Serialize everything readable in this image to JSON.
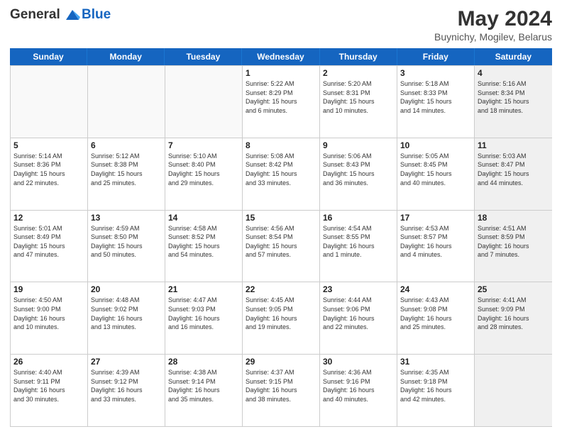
{
  "header": {
    "logo_line1": "General",
    "logo_line2": "Blue",
    "month_year": "May 2024",
    "location": "Buynichy, Mogilev, Belarus"
  },
  "days_of_week": [
    "Sunday",
    "Monday",
    "Tuesday",
    "Wednesday",
    "Thursday",
    "Friday",
    "Saturday"
  ],
  "weeks": [
    [
      {
        "day": "",
        "info": "",
        "empty": true
      },
      {
        "day": "",
        "info": "",
        "empty": true
      },
      {
        "day": "",
        "info": "",
        "empty": true
      },
      {
        "day": "1",
        "info": "Sunrise: 5:22 AM\nSunset: 8:29 PM\nDaylight: 15 hours\nand 6 minutes."
      },
      {
        "day": "2",
        "info": "Sunrise: 5:20 AM\nSunset: 8:31 PM\nDaylight: 15 hours\nand 10 minutes."
      },
      {
        "day": "3",
        "info": "Sunrise: 5:18 AM\nSunset: 8:33 PM\nDaylight: 15 hours\nand 14 minutes."
      },
      {
        "day": "4",
        "info": "Sunrise: 5:16 AM\nSunset: 8:34 PM\nDaylight: 15 hours\nand 18 minutes.",
        "shaded": true
      }
    ],
    [
      {
        "day": "5",
        "info": "Sunrise: 5:14 AM\nSunset: 8:36 PM\nDaylight: 15 hours\nand 22 minutes."
      },
      {
        "day": "6",
        "info": "Sunrise: 5:12 AM\nSunset: 8:38 PM\nDaylight: 15 hours\nand 25 minutes."
      },
      {
        "day": "7",
        "info": "Sunrise: 5:10 AM\nSunset: 8:40 PM\nDaylight: 15 hours\nand 29 minutes."
      },
      {
        "day": "8",
        "info": "Sunrise: 5:08 AM\nSunset: 8:42 PM\nDaylight: 15 hours\nand 33 minutes."
      },
      {
        "day": "9",
        "info": "Sunrise: 5:06 AM\nSunset: 8:43 PM\nDaylight: 15 hours\nand 36 minutes."
      },
      {
        "day": "10",
        "info": "Sunrise: 5:05 AM\nSunset: 8:45 PM\nDaylight: 15 hours\nand 40 minutes."
      },
      {
        "day": "11",
        "info": "Sunrise: 5:03 AM\nSunset: 8:47 PM\nDaylight: 15 hours\nand 44 minutes.",
        "shaded": true
      }
    ],
    [
      {
        "day": "12",
        "info": "Sunrise: 5:01 AM\nSunset: 8:49 PM\nDaylight: 15 hours\nand 47 minutes."
      },
      {
        "day": "13",
        "info": "Sunrise: 4:59 AM\nSunset: 8:50 PM\nDaylight: 15 hours\nand 50 minutes."
      },
      {
        "day": "14",
        "info": "Sunrise: 4:58 AM\nSunset: 8:52 PM\nDaylight: 15 hours\nand 54 minutes."
      },
      {
        "day": "15",
        "info": "Sunrise: 4:56 AM\nSunset: 8:54 PM\nDaylight: 15 hours\nand 57 minutes."
      },
      {
        "day": "16",
        "info": "Sunrise: 4:54 AM\nSunset: 8:55 PM\nDaylight: 16 hours\nand 1 minute."
      },
      {
        "day": "17",
        "info": "Sunrise: 4:53 AM\nSunset: 8:57 PM\nDaylight: 16 hours\nand 4 minutes."
      },
      {
        "day": "18",
        "info": "Sunrise: 4:51 AM\nSunset: 8:59 PM\nDaylight: 16 hours\nand 7 minutes.",
        "shaded": true
      }
    ],
    [
      {
        "day": "19",
        "info": "Sunrise: 4:50 AM\nSunset: 9:00 PM\nDaylight: 16 hours\nand 10 minutes."
      },
      {
        "day": "20",
        "info": "Sunrise: 4:48 AM\nSunset: 9:02 PM\nDaylight: 16 hours\nand 13 minutes."
      },
      {
        "day": "21",
        "info": "Sunrise: 4:47 AM\nSunset: 9:03 PM\nDaylight: 16 hours\nand 16 minutes."
      },
      {
        "day": "22",
        "info": "Sunrise: 4:45 AM\nSunset: 9:05 PM\nDaylight: 16 hours\nand 19 minutes."
      },
      {
        "day": "23",
        "info": "Sunrise: 4:44 AM\nSunset: 9:06 PM\nDaylight: 16 hours\nand 22 minutes."
      },
      {
        "day": "24",
        "info": "Sunrise: 4:43 AM\nSunset: 9:08 PM\nDaylight: 16 hours\nand 25 minutes."
      },
      {
        "day": "25",
        "info": "Sunrise: 4:41 AM\nSunset: 9:09 PM\nDaylight: 16 hours\nand 28 minutes.",
        "shaded": true
      }
    ],
    [
      {
        "day": "26",
        "info": "Sunrise: 4:40 AM\nSunset: 9:11 PM\nDaylight: 16 hours\nand 30 minutes."
      },
      {
        "day": "27",
        "info": "Sunrise: 4:39 AM\nSunset: 9:12 PM\nDaylight: 16 hours\nand 33 minutes."
      },
      {
        "day": "28",
        "info": "Sunrise: 4:38 AM\nSunset: 9:14 PM\nDaylight: 16 hours\nand 35 minutes."
      },
      {
        "day": "29",
        "info": "Sunrise: 4:37 AM\nSunset: 9:15 PM\nDaylight: 16 hours\nand 38 minutes."
      },
      {
        "day": "30",
        "info": "Sunrise: 4:36 AM\nSunset: 9:16 PM\nDaylight: 16 hours\nand 40 minutes."
      },
      {
        "day": "31",
        "info": "Sunrise: 4:35 AM\nSunset: 9:18 PM\nDaylight: 16 hours\nand 42 minutes."
      },
      {
        "day": "",
        "info": "",
        "empty": true,
        "shaded": true
      }
    ]
  ]
}
